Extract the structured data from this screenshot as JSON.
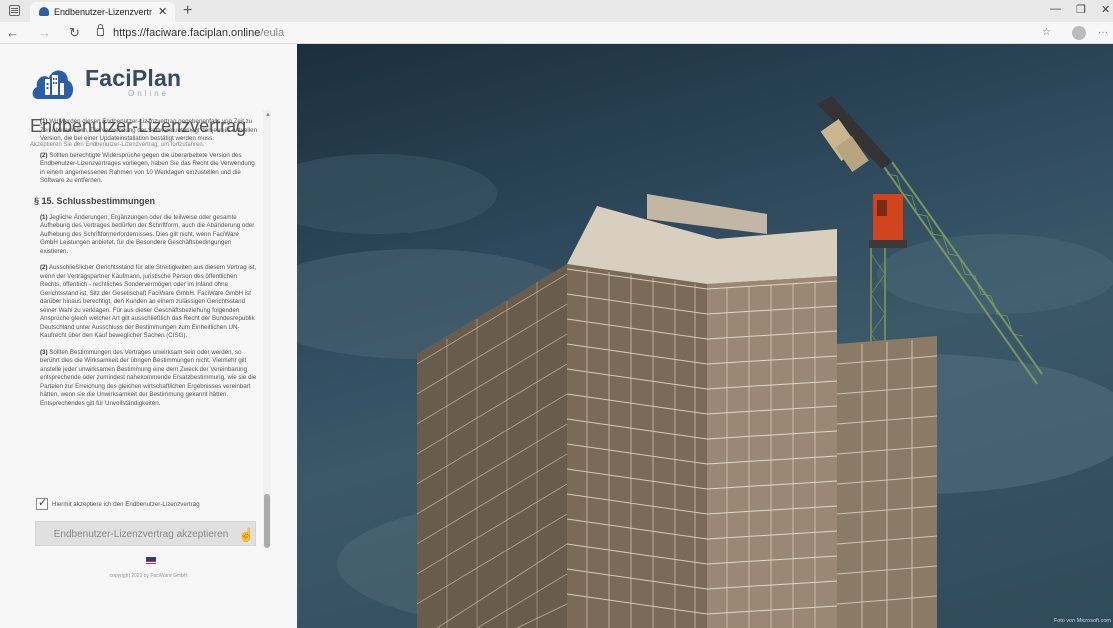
{
  "browser": {
    "tab_title": "Endbenutzer-Lizenzvertrag - FaciPlan",
    "tab_close": "✕",
    "new_tab": "+",
    "url_host": "https://faciware.faciplan.online",
    "url_path": "/eula",
    "window_controls": {
      "minimize": "—",
      "maximize": "❐",
      "close": "✕"
    },
    "more": "···"
  },
  "brand": {
    "name": "FaciPlan",
    "sub": "Online"
  },
  "page": {
    "title": "Endbenutzer-Lizenzvertrag",
    "subtitle": "Akzeptieren Sie den Endbenutzer-Lizenzvertrag, um fortzufahren."
  },
  "eula": {
    "p1_num": "(1)",
    "p1": " Wir werden diesen Endbenutzer-Lizenzvertrag gegebenenfalls von Zeit zu Zeit überarbeiten. Die Verwendung der Software unterliegt der jeweils aktuellen Version, die bei einer Updateinstallation bestätigt werden muss.",
    "p2_num": "(2)",
    "p2": " Sollten berechtigte Widersprüche gegen die überarbeitete Version des Endbenutzer-Lizenzvertrages vorliegen, haben Sie das Recht die Verwendung in einem angemessenen Rahmen von 10 Werktagen einzustellen und die Software zu entfernen.",
    "section": "§ 15. Schlussbestimmungen",
    "s1_num": "(1)",
    "s1": " Jegliche Änderungen, Ergänzungen oder die teilweise oder gesamte Aufhebung des Vertrages bedürfen der Schriftform, auch die Abänderung oder Aufhebung des Schriftformerfordernisses. Dies gilt nicht, wenn FaciWare GmbH Leistungen anbietet, für die Besondere Geschäftsbedingungen existieren.",
    "s2_num": "(2)",
    "s2": " Ausschließlicher Gerichtsstand für alle Streitigkeiten aus diesem Vertrag ist, wenn der Vertragspartner Kaufmann, juristische Person des öffentlichen Rechts, öffentlich - rechtliches Sondervermögen oder im Inland ohne Gerichtsstand ist, Sitz der Gesellschaft FaciWare GmbH. FaciWare GmbH ist darüber hinaus berechtigt, den Kunden an einem zulässigen Gerichtsstand seiner Wahl zu verklagen. Für aus dieser Geschäftsbeziehung folgenden Ansprüche gleich welcher Art gilt ausschließlich das Recht der Bundesrepublik Deutschland unter Ausschluss der Bestimmungen zum Einheitlichen UN-Kaufrecht über den Kauf beweglicher Sachen (CISG).",
    "s3_num": "(3)",
    "s3": " Sollten Bestimmungen des Vertrages unwirksam sein oder werden, so berührt dies die Wirksamkeit der übrigen Bestimmungen nicht. Vielmehr gilt anstelle jeder unwirksamen Bestimmung eine dem Zweck der Vereinbarung entsprechende oder zumindest nahekommende Ersatzbestimmung, wie sie die Parteien zur Erreichung des gleichen wirtschaftlichen Ergebnisses vereinbart hätten, wenn sie die Unwirksamkeit der Bestimmung gekannt hätten. Entsprechendes gilt für Unvollständigkeiten."
  },
  "accept": {
    "checkbox_label": "Hiermit akzeptiere ich den Endbenutzer-Lizenzvertrag",
    "checked": true,
    "button_label": "Endbenutzer-Lizenzvertrag akzeptieren"
  },
  "footer": {
    "copyright": "copyright 2021 by FaciWare GmbH"
  },
  "hero": {
    "credit": "Foto von Microsoft.com"
  },
  "colors": {
    "brand": "#3b4a63",
    "logo_blue": "#2a5ea8",
    "sky": "#2e4a5c",
    "crane_orange": "#d2441c"
  }
}
